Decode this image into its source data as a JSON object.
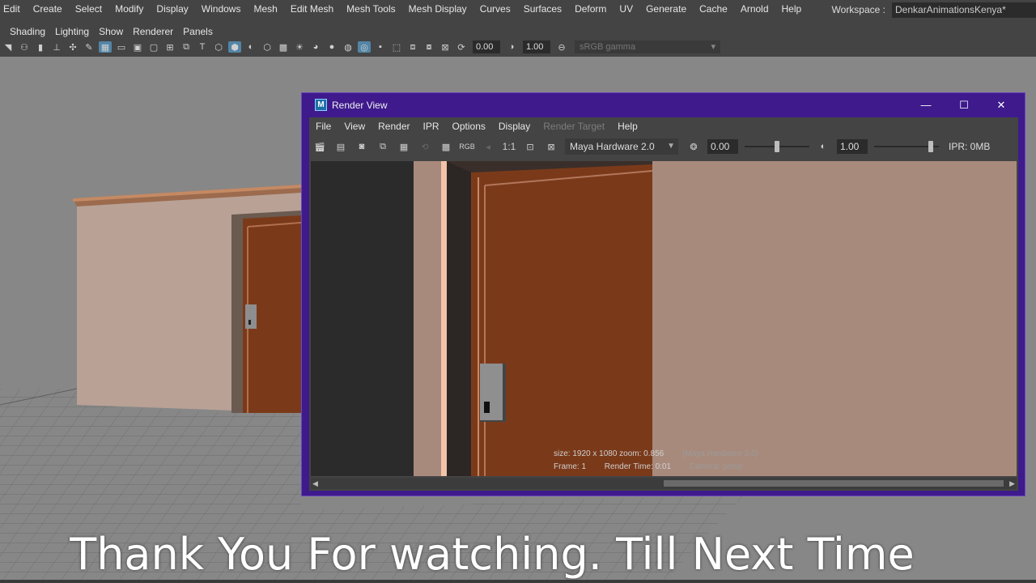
{
  "main_menu": {
    "items": [
      "Edit",
      "Create",
      "Select",
      "Modify",
      "Display",
      "Windows",
      "Mesh",
      "Edit Mesh",
      "Mesh Tools",
      "Mesh Display",
      "Curves",
      "Surfaces",
      "Deform",
      "UV",
      "Generate",
      "Cache",
      "Arnold",
      "Help"
    ],
    "workspace_label": "Workspace :",
    "workspace_value": "DenkarAnimationsKenya*"
  },
  "panel_menu": {
    "items": [
      "Shading",
      "Lighting",
      "Show",
      "Renderer",
      "Panels"
    ]
  },
  "panel_toolbar": {
    "exposure": "0.00",
    "gamma": "1.00",
    "colorspace": "sRGB gamma"
  },
  "render_view": {
    "title": "Render View",
    "logo_letter": "M",
    "menu": [
      "File",
      "View",
      "Render",
      "IPR",
      "Options",
      "Display",
      "Render Target",
      "Help"
    ],
    "toolbar": {
      "ratio_label": "1:1",
      "rgb_label": "RGB",
      "renderer": "Maya Hardware 2.0",
      "exposure": "0.00",
      "gamma": "1.00",
      "ipr_memory": "IPR: 0MB",
      "exposure_fraction": 0.5,
      "gamma_fraction": 0.9
    },
    "info": {
      "size_line": "size: 1920 x 1080 zoom: 0.856",
      "renderer_note": "(Maya Hardware 2.0)",
      "frame": "Frame: 1",
      "render_time": "Render Time: 0:01",
      "camera": "Camera: persp"
    }
  },
  "caption": "Thank You For watching. Till Next Time",
  "colors": {
    "window_title_bar": "#3e1a8c",
    "door": "#7a3a1a",
    "wall": "#a88a7c",
    "highlight": "#5285a6"
  }
}
